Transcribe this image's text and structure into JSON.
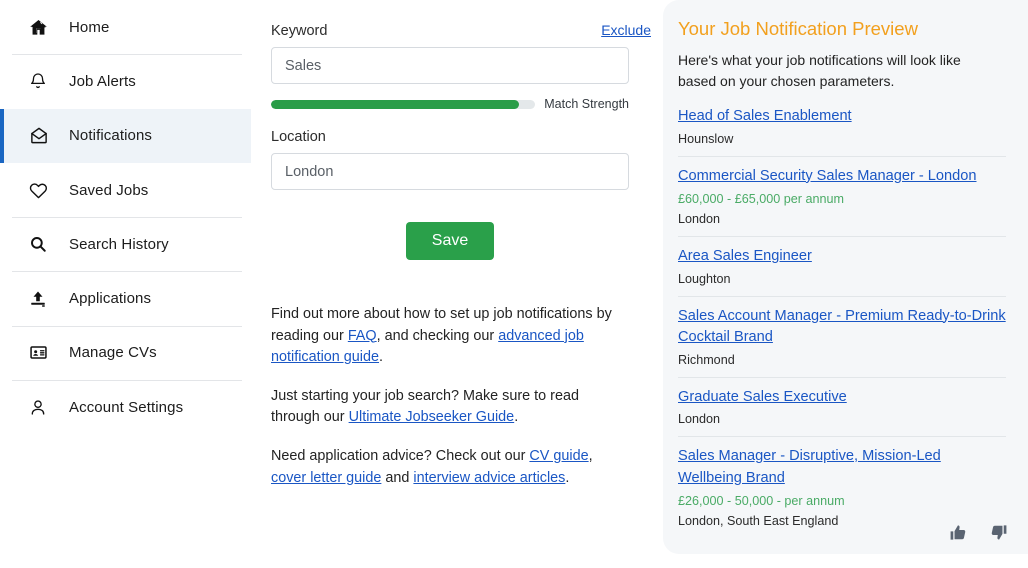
{
  "sidebar": {
    "items": [
      {
        "label": "Home",
        "icon": "home-icon",
        "active": false
      },
      {
        "label": "Job Alerts",
        "icon": "bell-icon",
        "active": false
      },
      {
        "label": "Notifications",
        "icon": "envelope-open-icon",
        "active": true
      },
      {
        "label": "Saved Jobs",
        "icon": "heart-icon",
        "active": false
      },
      {
        "label": "Search History",
        "icon": "search-icon",
        "active": false
      },
      {
        "label": "Applications",
        "icon": "upload-icon",
        "active": false
      },
      {
        "label": "Manage CVs",
        "icon": "id-card-icon",
        "active": false
      },
      {
        "label": "Account Settings",
        "icon": "user-icon",
        "active": false
      }
    ]
  },
  "form": {
    "keyword_label": "Keyword",
    "exclude_link": "Exclude",
    "keyword_value": "Sales",
    "keyword_placeholder": "Keyword",
    "match_strength_label": "Match Strength",
    "match_strength_percent": 94,
    "location_label": "Location",
    "location_value": "London",
    "location_placeholder": "Location",
    "save_label": "Save"
  },
  "help": {
    "para1_a": "Find out more about how to set up job notifications by reading our ",
    "para1_link1": "FAQ",
    "para1_b": ", and checking our ",
    "para1_link2": "advanced job notification guide",
    "para1_c": ".",
    "para2_a": "Just starting your job search? Make sure to read through our ",
    "para2_link1": "Ultimate Jobseeker Guide",
    "para2_b": ".",
    "para3_a": "Need application advice? Check out our ",
    "para3_link1": "CV guide",
    "para3_b": ", ",
    "para3_link2": "cover letter guide",
    "para3_c": " and ",
    "para3_link3": "interview advice articles",
    "para3_d": "."
  },
  "preview": {
    "title": "Your Job Notification Preview",
    "subtitle": "Here's what your job notifications will look like based on your chosen parameters.",
    "jobs": [
      {
        "title": "Head of Sales Enablement",
        "salary": "",
        "location": "Hounslow"
      },
      {
        "title": "Commercial Security Sales Manager - London",
        "salary": "£60,000 - £65,000 per annum",
        "location": "London"
      },
      {
        "title": "Area Sales Engineer",
        "salary": "",
        "location": "Loughton"
      },
      {
        "title": "Sales Account Manager - Premium Ready-to-Drink Cocktail Brand",
        "salary": "",
        "location": "Richmond"
      },
      {
        "title": "Graduate Sales Executive",
        "salary": "",
        "location": "London"
      },
      {
        "title": "Sales Manager - Disruptive, Mission-Led Wellbeing Brand",
        "salary": "£26,000 - 50,000 - per annum",
        "location": "London, South East England"
      }
    ],
    "feedback": {
      "thumbs_up": "thumbs-up-icon",
      "thumbs_down": "thumbs-down-icon"
    }
  },
  "colors": {
    "accent_blue": "#1a56c4",
    "active_blue": "#1a66c2",
    "save_green": "#2aa04a",
    "strength_green": "#2a9d48",
    "salary_green": "#4aab66",
    "preview_orange": "#f2a01e",
    "panel_bg": "#f5f7f9",
    "active_bg": "#eef3f8"
  }
}
